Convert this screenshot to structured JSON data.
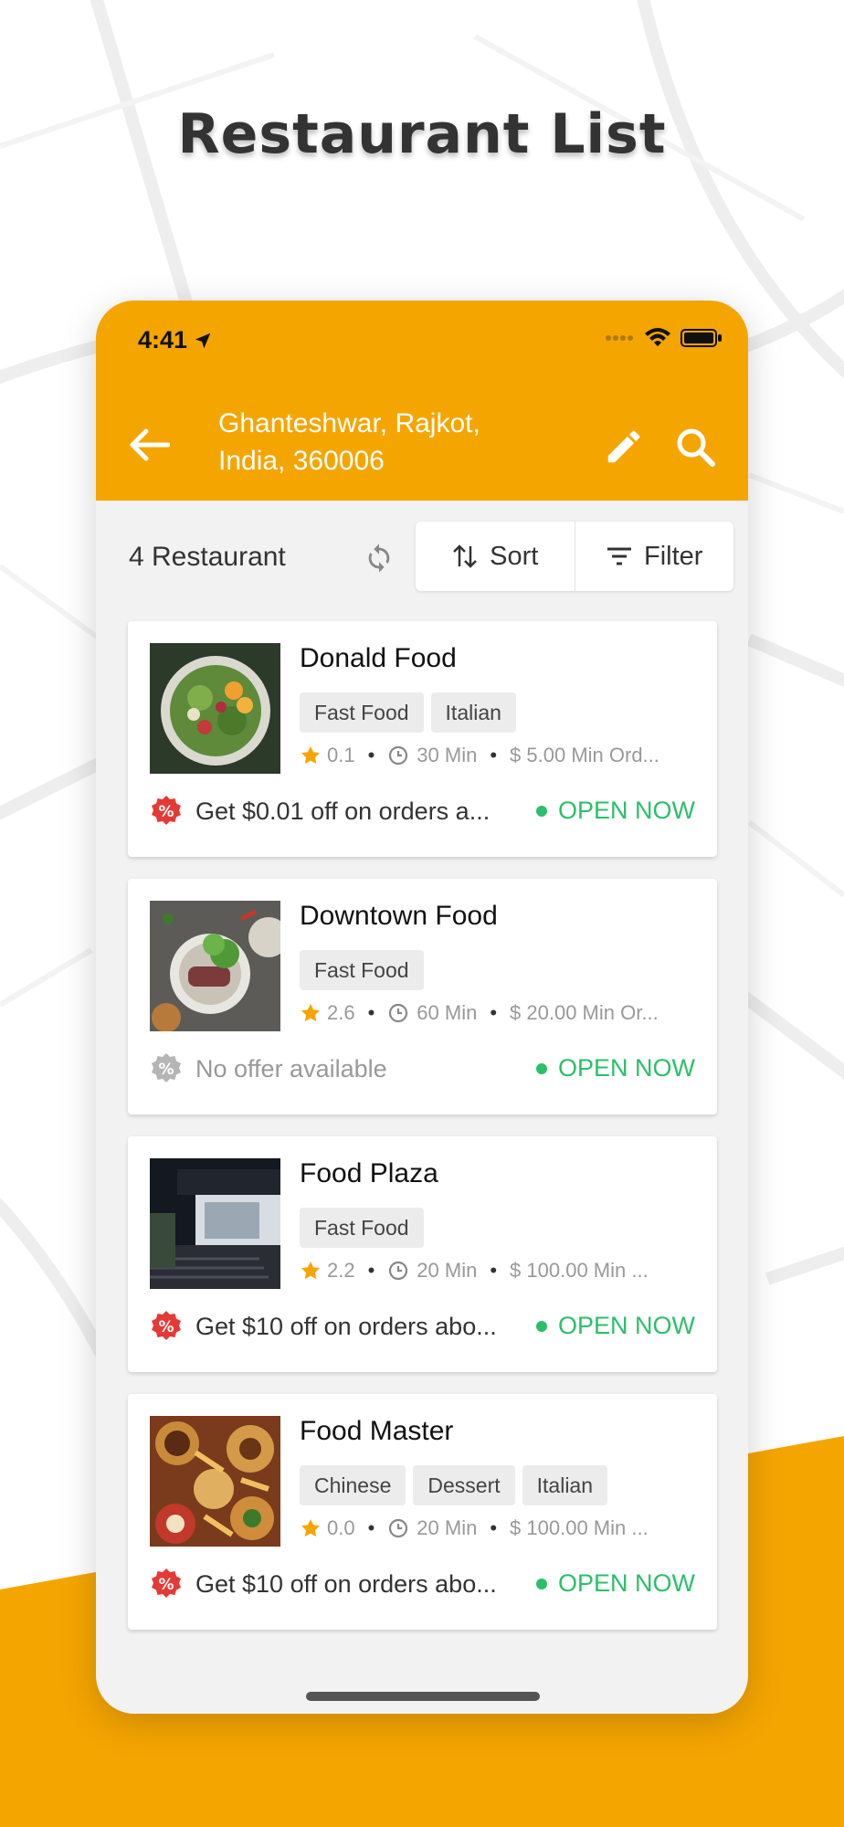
{
  "page_title": "Restaurant List",
  "colors": {
    "accent": "#f5a500",
    "open": "#2bbf6a",
    "offer": "#e53935"
  },
  "status_bar": {
    "time": "4:41"
  },
  "header": {
    "location_line1": "Ghanteshwar, Rajkot,",
    "location_line2": "India, 360006",
    "back_icon": "arrow-left-icon",
    "edit_icon": "pencil-icon",
    "search_icon": "search-icon"
  },
  "toolbar": {
    "count_label": "4 Restaurant",
    "sort_label": "Sort",
    "filter_label": "Filter"
  },
  "restaurants": [
    {
      "name": "Donald Food",
      "tags": [
        "Fast Food",
        "Italian"
      ],
      "rating": "0.1",
      "time": "30 Min",
      "min_order": "$ 5.00 Min Ord...",
      "offer": "Get $0.01 off on orders a...",
      "has_offer": true,
      "status": "OPEN NOW"
    },
    {
      "name": "Downtown Food",
      "tags": [
        "Fast Food"
      ],
      "rating": "2.6",
      "time": "60 Min",
      "min_order": "$ 20.00 Min Or...",
      "offer": "No offer available",
      "has_offer": false,
      "status": "OPEN NOW"
    },
    {
      "name": "Food Plaza",
      "tags": [
        "Fast Food"
      ],
      "rating": "2.2",
      "time": "20 Min",
      "min_order": "$ 100.00 Min ...",
      "offer": "Get $10 off on orders abo...",
      "has_offer": true,
      "status": "OPEN NOW"
    },
    {
      "name": "Food Master",
      "tags": [
        "Chinese",
        "Dessert",
        "Italian"
      ],
      "rating": "0.0",
      "time": "20 Min",
      "min_order": "$ 100.00 Min ...",
      "offer": "Get $10 off on orders abo...",
      "has_offer": true,
      "status": "OPEN NOW"
    }
  ]
}
